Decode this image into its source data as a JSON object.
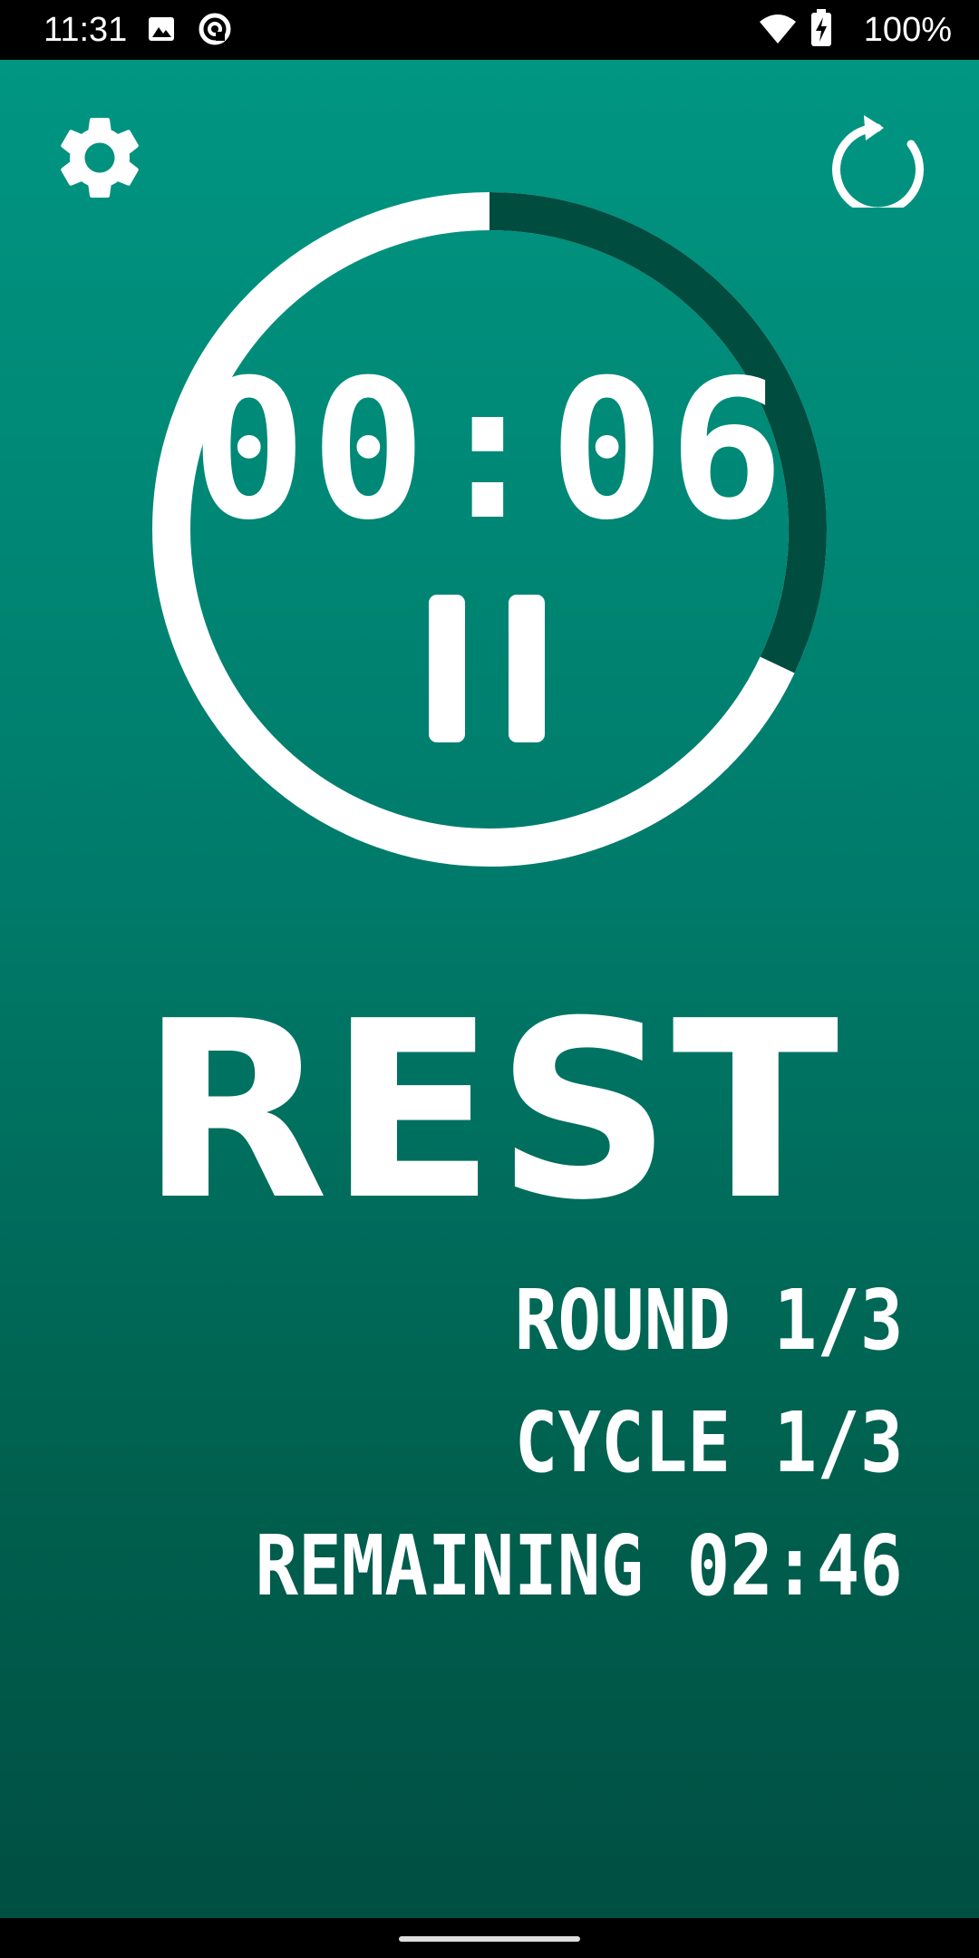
{
  "status_bar": {
    "time": "11:31",
    "battery": "100%",
    "icons": [
      "image-icon",
      "sync-icon",
      "wifi-icon",
      "battery-charging-icon"
    ]
  },
  "toolbar": {
    "settings_icon": "gear-icon",
    "reset_icon": "restart-icon"
  },
  "timer": {
    "display": "00:06",
    "state_icon": "pause-icon",
    "progress": 0.32
  },
  "workout": {
    "phase": "REST",
    "round": "ROUND 1/3",
    "cycle": "CYCLE 1/3",
    "remaining": "REMAINING 02:46"
  },
  "colors": {
    "gradient_top": "#009682",
    "gradient_bottom": "#004f43",
    "ring_elapsed": "#004d40",
    "ring_remaining": "#ffffff",
    "text": "#ffffff"
  }
}
